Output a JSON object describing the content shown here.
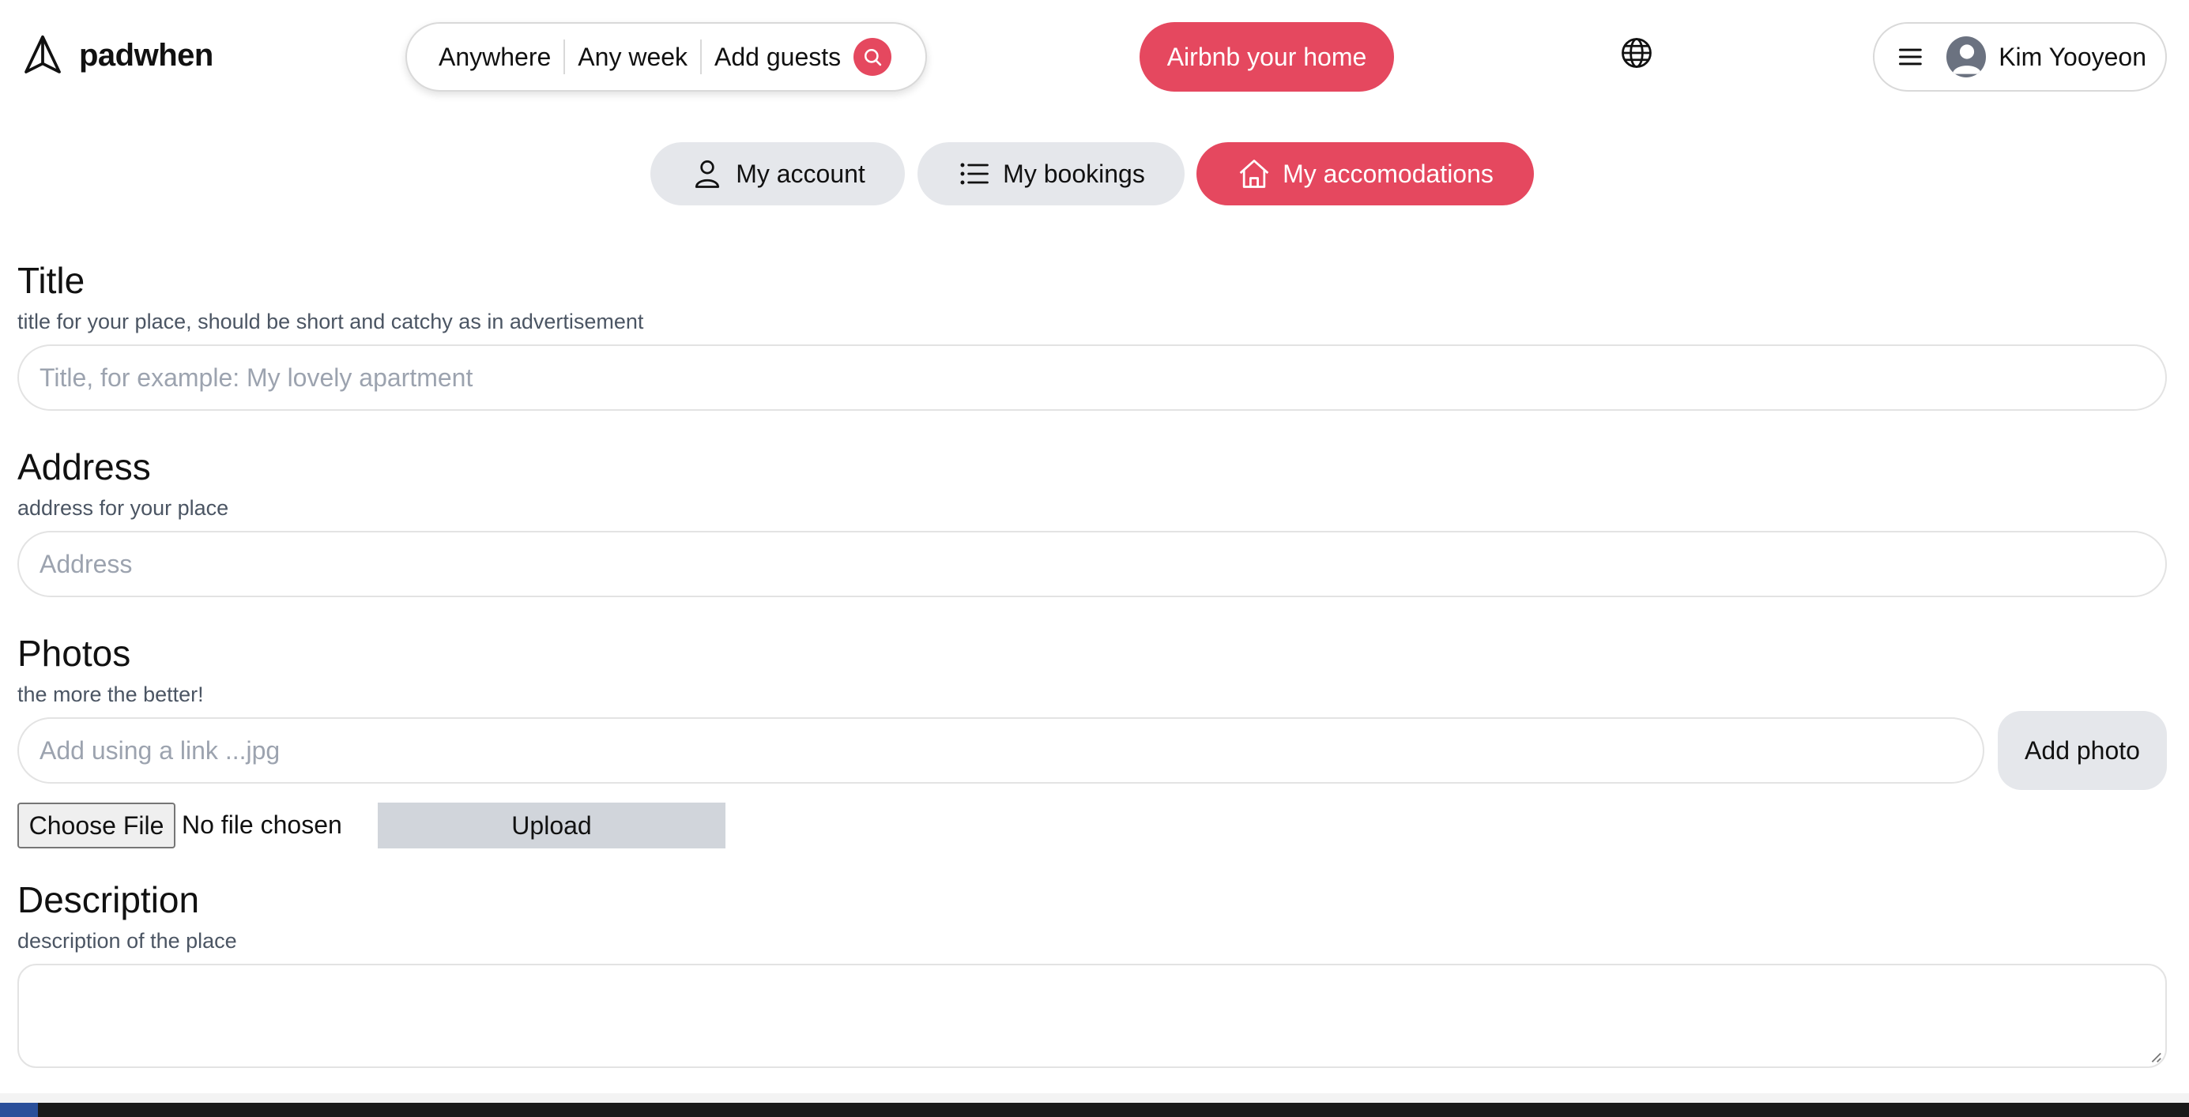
{
  "header": {
    "logo_text": "padwhen",
    "search": {
      "where": "Anywhere",
      "when": "Any week",
      "guests": "Add guests"
    },
    "host_button": "Airbnb your home",
    "user_name": "Kim Yooyeon"
  },
  "tabs": [
    {
      "label": "My account",
      "icon": "user-icon",
      "active": false
    },
    {
      "label": "My bookings",
      "icon": "list-icon",
      "active": false
    },
    {
      "label": "My accomodations",
      "icon": "home-icon",
      "active": true
    }
  ],
  "form": {
    "title": {
      "heading": "Title",
      "hint": "title for your place, should be short and catchy as in advertisement",
      "placeholder": "Title, for example: My lovely apartment"
    },
    "address": {
      "heading": "Address",
      "hint": "address for your place",
      "placeholder": "Address"
    },
    "photos": {
      "heading": "Photos",
      "hint": "the more the better!",
      "placeholder": "Add using a link ...jpg",
      "add_button": "Add photo",
      "choose_file": "Choose File",
      "file_status": "No file chosen",
      "upload_button": "Upload"
    },
    "description": {
      "heading": "Description",
      "hint": "description of the place"
    }
  },
  "colors": {
    "accent": "#e5485f",
    "tab_inactive": "#e5e7eb",
    "hint_text": "#4b5563",
    "placeholder_text": "#9ca3af"
  }
}
